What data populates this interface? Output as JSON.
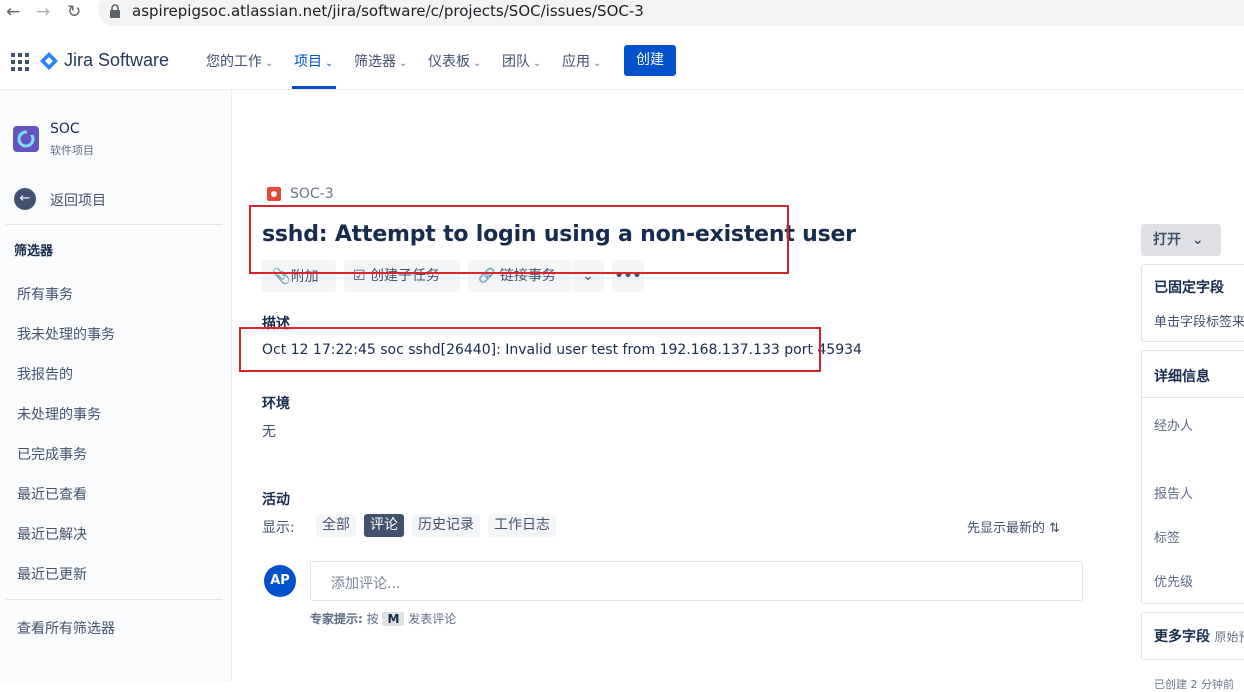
{
  "browser": {
    "back_icon": "arrow-left",
    "forward_icon": "arrow-right",
    "reload_icon": "reload",
    "url": "aspirepigsoc.atlassian.net/jira/software/c/projects/SOC/issues/SOC-3"
  },
  "topnav": {
    "product": "Jira Software",
    "items": [
      {
        "label": "您的工作"
      },
      {
        "label": "项目"
      },
      {
        "label": "筛选器"
      },
      {
        "label": "仪表板"
      },
      {
        "label": "团队"
      },
      {
        "label": "应用"
      }
    ],
    "create_label": "创建",
    "colors": {
      "accent": "#0052cc"
    }
  },
  "sidebar": {
    "project_name": "SOC",
    "project_type": "软件项目",
    "back_label": "返回项目",
    "filters_heading": "筛选器",
    "filters": [
      "所有事务",
      "我未处理的事务",
      "我报告的",
      "未处理的事务",
      "已完成事务",
      "最近已查看",
      "最近已解决",
      "最近已更新"
    ],
    "view_all": "查看所有筛选器"
  },
  "issue": {
    "key": "SOC-3",
    "title": "sshd: Attempt to login using a non-existent user",
    "actions": {
      "attach": "附加",
      "subtask": "创建子任务",
      "link": "链接事务"
    },
    "description_heading": "描述",
    "description": "Oct 12 17:22:45 soc sshd[26440]: Invalid user test from 192.168.137.133 port 45934",
    "environment_heading": "环境",
    "environment": "无"
  },
  "activity": {
    "heading": "活动",
    "show_label": "显示:",
    "tabs": [
      "全部",
      "评论",
      "历史记录",
      "工作日志"
    ],
    "selected_tab": "评论",
    "sort_label": "先显示最新的",
    "avatar_initials": "AP",
    "comment_placeholder": "添加评论...",
    "tip_prefix": "专家提示:",
    "tip_press": "按",
    "tip_key": "M",
    "tip_suffix": "发表评论"
  },
  "right_panel": {
    "status_label": "打开",
    "pinned_heading": "已固定字段",
    "pinned_hint": "单击字段标签来",
    "details_heading": "详细信息",
    "fields": [
      "经办人",
      "报告人",
      "标签",
      "优先级"
    ],
    "more_heading": "更多字段",
    "more_sub": "原始预",
    "footer_partial": "已创建 2 分钟前"
  }
}
